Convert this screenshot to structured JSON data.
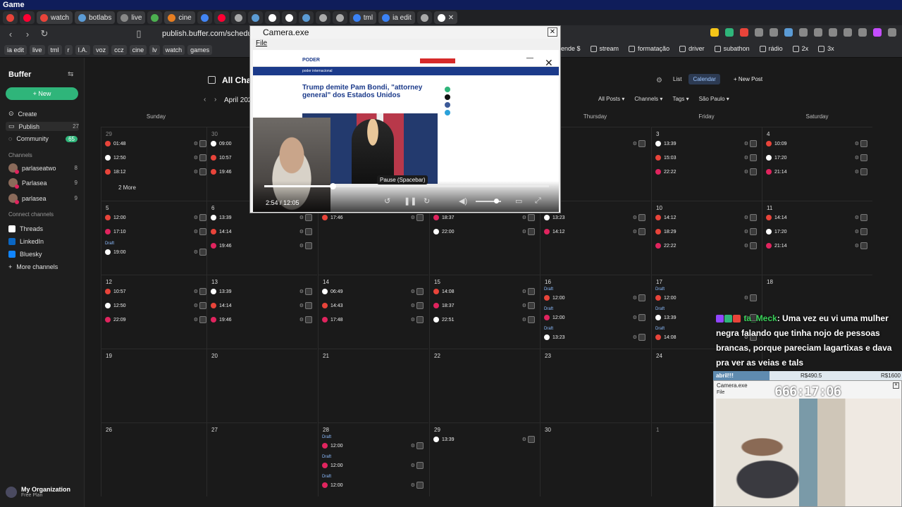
{
  "os": {
    "title": "Game"
  },
  "tabs": [
    {
      "label": "",
      "color": "#e8443a"
    },
    {
      "label": "",
      "color": "#ff0033"
    },
    {
      "label": "watch",
      "color": "#e8443a"
    },
    {
      "label": "botlabs",
      "color": "#5b9bd5"
    },
    {
      "label": "live",
      "color": "#888888"
    },
    {
      "label": "",
      "color": "#4caf50"
    },
    {
      "label": "cine",
      "color": "#e67e22"
    },
    {
      "label": "",
      "color": "#4285f4"
    },
    {
      "label": "",
      "color": "#ff0033"
    },
    {
      "label": "",
      "color": "#aaaaaa"
    },
    {
      "label": "",
      "color": "#5b9bd5"
    },
    {
      "label": "",
      "color": "#ffffff"
    },
    {
      "label": "",
      "color": "#ffffff"
    },
    {
      "label": "",
      "color": "#5b9bd5"
    },
    {
      "label": "",
      "color": "#aaaaaa"
    },
    {
      "label": "",
      "color": "#aaaaaa"
    },
    {
      "label": "tml",
      "color": "#3b82f6"
    },
    {
      "label": "ia edit",
      "color": "#3b82f6"
    },
    {
      "label": "",
      "color": "#aaaaaa"
    },
    {
      "label": "✕",
      "color": "#ffffff"
    }
  ],
  "address": {
    "url": "publish.buffer.com/schedule/c"
  },
  "bookmarks": [
    "ia edit",
    "live",
    "tml",
    "r",
    "I.A.",
    "voz",
    "ccz",
    "cine",
    "lv",
    "watch",
    "games"
  ],
  "bookmarks_right": [
    "rende $",
    "stream",
    "formatação",
    "driver",
    "subathon",
    "rádio",
    "2x",
    "3x"
  ],
  "sidebar": {
    "brand": "Buffer",
    "new_label": "New",
    "items": [
      {
        "label": "Create",
        "count": ""
      },
      {
        "label": "Publish",
        "count": "27"
      },
      {
        "label": "Community",
        "count": "65"
      }
    ],
    "channels_heading": "Channels",
    "channels": [
      {
        "label": "parlaseatwo",
        "count": "8"
      },
      {
        "label": "Parlasea",
        "count": "9"
      },
      {
        "label": "parlasea",
        "count": "9"
      }
    ],
    "connect_heading": "Connect channels",
    "connect": [
      {
        "label": "Threads",
        "color": "#ffffff"
      },
      {
        "label": "LinkedIn",
        "color": "#0a66c2"
      },
      {
        "label": "Bluesky",
        "color": "#1185fe"
      }
    ],
    "more_channels": "More channels",
    "org_name": "My Organization",
    "org_plan": "Free Plan"
  },
  "main": {
    "title": "All Cha",
    "month": "April 202",
    "view_list": "List",
    "view_calendar": "Calendar",
    "new_post": "New Post",
    "filters": [
      "All Posts",
      "Channels",
      "Tags",
      "São Paulo"
    ],
    "weekdays": [
      "Sunday",
      "",
      "",
      "",
      "Thursday",
      "Friday",
      "Saturday"
    ]
  },
  "calendar": {
    "weeks": [
      {
        "days": [
          {
            "num": "29",
            "dim": true,
            "posts": [
              {
                "t": "01:48",
                "c": "#e8443a"
              },
              {
                "t": "12:50",
                "c": "#ffffff"
              },
              {
                "t": "18:12",
                "c": "#e8443a"
              }
            ],
            "more": "2 More"
          },
          {
            "num": "30",
            "dim": true,
            "posts": [
              {
                "t": "09:00",
                "c": "#ffffff"
              },
              {
                "t": "10:57",
                "c": "#e8443a"
              },
              {
                "t": "19:46",
                "c": "#e8443a"
              }
            ]
          },
          {
            "num": "",
            "posts": []
          },
          {
            "num": "",
            "posts": []
          },
          {
            "num": "",
            "posts": [
              {
                "t": "",
                "c": "#e8443a"
              }
            ]
          },
          {
            "num": "3",
            "posts": [
              {
                "t": "13:39",
                "c": "#ffffff"
              },
              {
                "t": "15:03",
                "c": "#e8443a"
              },
              {
                "t": "22:22",
                "c": "#e0245e"
              }
            ]
          },
          {
            "num": "4",
            "posts": [
              {
                "t": "10:09",
                "c": "#e8443a"
              },
              {
                "t": "17:20",
                "c": "#ffffff"
              },
              {
                "t": "21:14",
                "c": "#e0245e"
              }
            ]
          }
        ]
      },
      {
        "days": [
          {
            "num": "5",
            "posts": [
              {
                "t": "12:00",
                "c": "#e8443a"
              },
              {
                "t": "17:10",
                "c": "#e0245e"
              },
              {
                "t": "19:00",
                "c": "#ffffff",
                "draft": "Draft"
              }
            ]
          },
          {
            "num": "6",
            "posts": [
              {
                "t": "13:39",
                "c": "#ffffff"
              },
              {
                "t": "14:14",
                "c": "#e8443a"
              },
              {
                "t": "19:46",
                "c": "#e0245e"
              }
            ]
          },
          {
            "num": "",
            "posts": [
              {
                "t": "17:46",
                "c": "#e8443a"
              }
            ]
          },
          {
            "num": "",
            "posts": [
              {
                "t": "18:37",
                "c": "#e0245e"
              },
              {
                "t": "22:00",
                "c": "#ffffff"
              }
            ]
          },
          {
            "num": "",
            "posts": [
              {
                "t": "13:23",
                "c": "#ffffff"
              },
              {
                "t": "14:12",
                "c": "#e0245e"
              }
            ]
          },
          {
            "num": "10",
            "posts": [
              {
                "t": "14:12",
                "c": "#e8443a"
              },
              {
                "t": "18:29",
                "c": "#e8443a"
              },
              {
                "t": "22:22",
                "c": "#e0245e"
              }
            ]
          },
          {
            "num": "11",
            "posts": [
              {
                "t": "14:14",
                "c": "#e8443a"
              },
              {
                "t": "17:20",
                "c": "#ffffff"
              },
              {
                "t": "21:14",
                "c": "#e0245e"
              }
            ]
          }
        ]
      },
      {
        "days": [
          {
            "num": "12",
            "posts": [
              {
                "t": "10:57",
                "c": "#e8443a"
              },
              {
                "t": "12:50",
                "c": "#ffffff"
              },
              {
                "t": "22:09",
                "c": "#e0245e"
              }
            ]
          },
          {
            "num": "13",
            "posts": [
              {
                "t": "13:39",
                "c": "#ffffff"
              },
              {
                "t": "14:14",
                "c": "#e8443a"
              },
              {
                "t": "19:46",
                "c": "#e0245e"
              }
            ]
          },
          {
            "num": "14",
            "posts": [
              {
                "t": "06:49",
                "c": "#ffffff"
              },
              {
                "t": "14:43",
                "c": "#e8443a"
              },
              {
                "t": "17:48",
                "c": "#e0245e"
              }
            ]
          },
          {
            "num": "15",
            "posts": [
              {
                "t": "14:08",
                "c": "#e8443a"
              },
              {
                "t": "18:37",
                "c": "#e0245e"
              },
              {
                "t": "22:51",
                "c": "#ffffff"
              }
            ]
          },
          {
            "num": "16",
            "posts": [
              {
                "t": "12:00",
                "c": "#e8443a",
                "draft": "Draft"
              },
              {
                "t": "12:00",
                "c": "#e0245e",
                "draft": "Draft"
              },
              {
                "t": "13:23",
                "c": "#ffffff",
                "draft": "Draft"
              }
            ]
          },
          {
            "num": "17",
            "posts": [
              {
                "t": "12:00",
                "c": "#e8443a",
                "draft": "Draft"
              },
              {
                "t": "13:39",
                "c": "#ffffff",
                "draft": "Draft"
              },
              {
                "t": "14:08",
                "c": "#e8443a",
                "draft": "Draft"
              }
            ]
          },
          {
            "num": "18",
            "posts": []
          }
        ]
      },
      {
        "days": [
          {
            "num": "19",
            "posts": []
          },
          {
            "num": "20",
            "posts": []
          },
          {
            "num": "21",
            "posts": []
          },
          {
            "num": "22",
            "posts": []
          },
          {
            "num": "23",
            "posts": []
          },
          {
            "num": "24",
            "posts": []
          },
          {
            "num": "",
            "posts": []
          }
        ]
      },
      {
        "days": [
          {
            "num": "26",
            "posts": []
          },
          {
            "num": "27",
            "posts": []
          },
          {
            "num": "28",
            "posts": [
              {
                "t": "12:00",
                "c": "#e0245e",
                "draft": "Draft"
              },
              {
                "t": "12:00",
                "c": "#e0245e",
                "draft": "Draft"
              },
              {
                "t": "12:00",
                "c": "#e0245e",
                "draft": "Draft"
              }
            ]
          },
          {
            "num": "29",
            "posts": [
              {
                "t": "13:39",
                "c": "#ffffff"
              }
            ]
          },
          {
            "num": "30",
            "posts": []
          },
          {
            "num": "1",
            "dim": true,
            "posts": []
          },
          {
            "num": "",
            "posts": []
          }
        ]
      }
    ]
  },
  "camera_window": {
    "title": "Camera.exe",
    "menu": "File",
    "close": "✕",
    "site_logo": "PODER",
    "section": "poder internacional",
    "headline": "Trump demite Pam Bondi, \"attorney general\" dos Estados Unidos",
    "tooltip": "Pause (Spacebar)",
    "time": "2:54 / 12:05",
    "progress": 0.24,
    "volume": 0.8
  },
  "chat": {
    "user": "ta_Meck",
    "message": ": Uma vez eu vi uma mulher negra falando que tinha nojo de pessoas brancas, porque pareciam lagartixas e dava pra ver as veias e tals",
    "badge_colors": [
      "#9146ff",
      "#2fb57a",
      "#e8443a"
    ]
  },
  "stream_overlay": {
    "goal_label": "abril!!!",
    "goal_value": "R$490.5",
    "goal_total": "R$1600",
    "goal_fraction": 0.3,
    "cam_title": "Camera.exe",
    "cam_menu": "File",
    "timer": "666:17:06"
  },
  "colors": {
    "accent": "#2fb57a",
    "youtube": "#e8443a",
    "instagram": "#e0245e"
  }
}
